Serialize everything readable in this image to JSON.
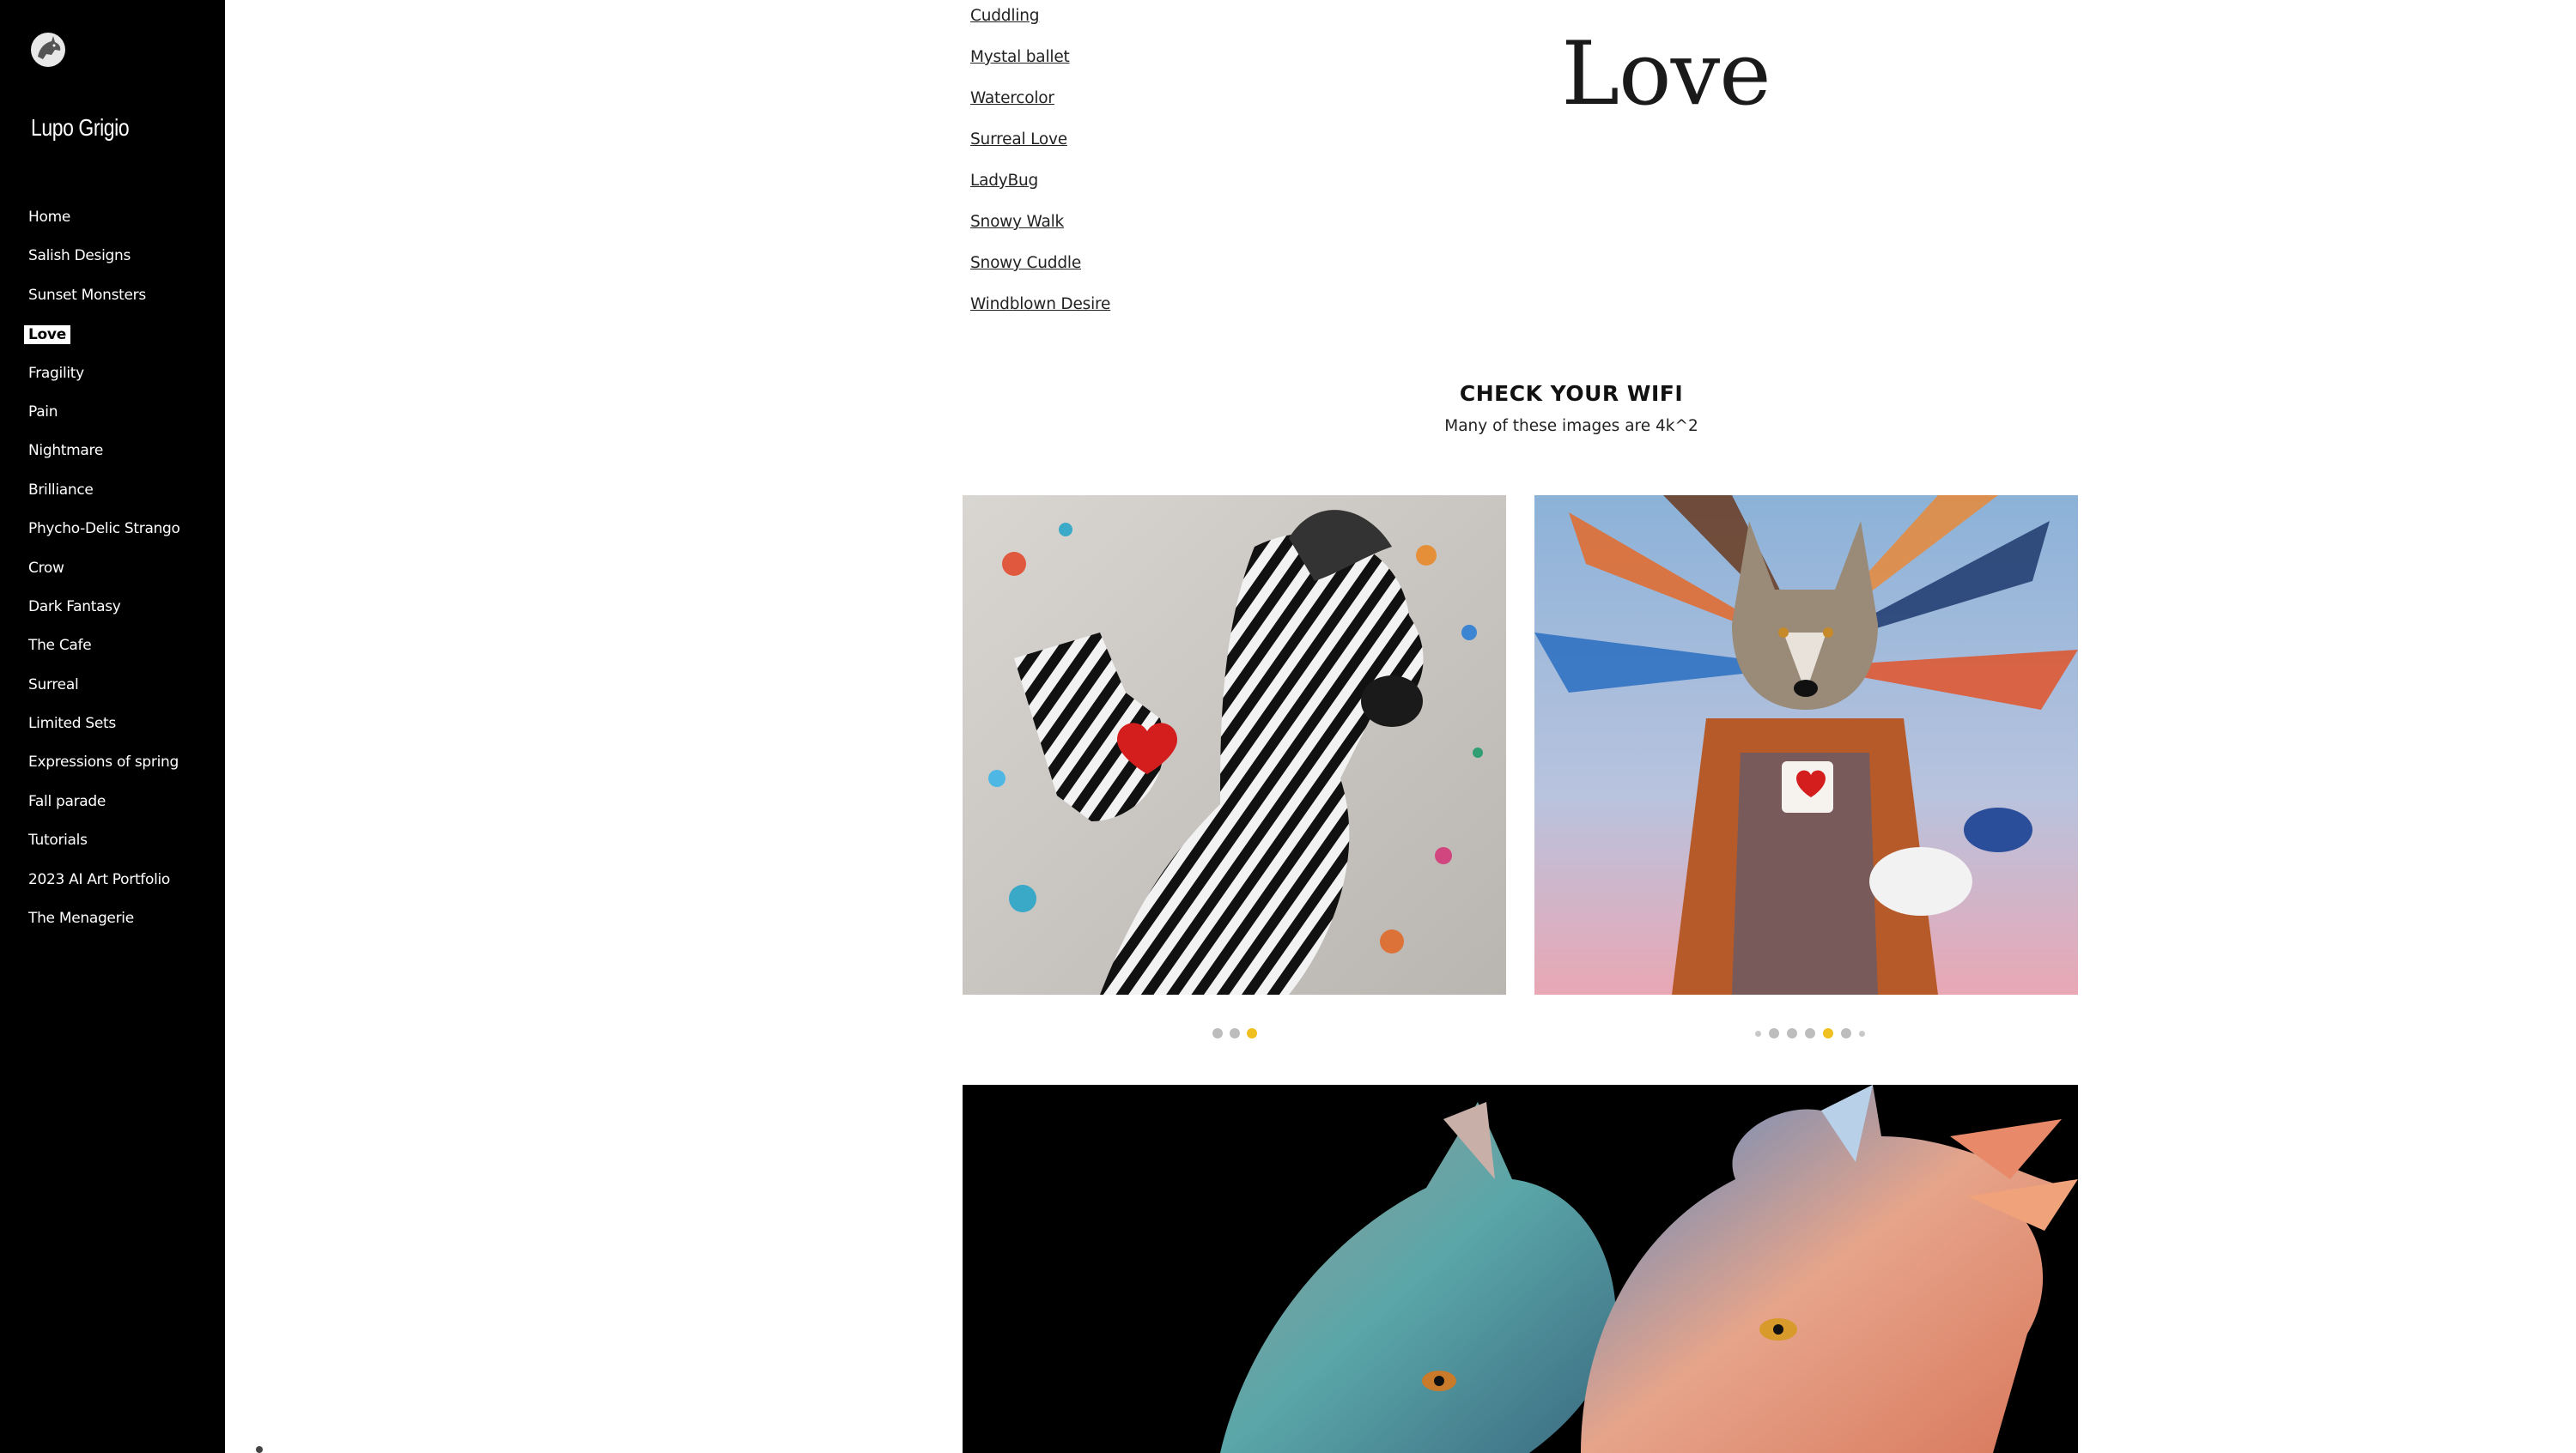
{
  "site": {
    "title": "Lupo Grigio",
    "logo_icon": "wolf-moon-logo-icon"
  },
  "nav": {
    "items": [
      {
        "label": "Home"
      },
      {
        "label": "Salish Designs"
      },
      {
        "label": "Sunset Monsters"
      },
      {
        "label": "Love",
        "active": true
      },
      {
        "label": "Fragility"
      },
      {
        "label": "Pain"
      },
      {
        "label": "Nightmare"
      },
      {
        "label": "Brilliance"
      },
      {
        "label": "Phycho-Delic Strango"
      },
      {
        "label": "Crow"
      },
      {
        "label": "Dark Fantasy"
      },
      {
        "label": "The Cafe"
      },
      {
        "label": "Surreal"
      },
      {
        "label": "Limited Sets"
      },
      {
        "label": "Expressions of spring"
      },
      {
        "label": "Fall parade"
      },
      {
        "label": "Tutorials"
      },
      {
        "label": "2023 AI Art Portfolio"
      },
      {
        "label": "The Menagerie"
      }
    ]
  },
  "content": {
    "links": [
      "Cuddling",
      "Mystal ballet",
      "Watercolor",
      "Surreal Love",
      "LadyBug",
      "Snowy Walk",
      "Snowy Cuddle",
      "Windblown Desire"
    ],
    "page_title": "Love",
    "wifi_heading": "CHECK YOUR WIFI",
    "wifi_subtext": "Many of these images are 4k^2"
  },
  "galleries": [
    {
      "subject": "zebra with heart glove",
      "slides": 3,
      "active_slide": 3
    },
    {
      "subject": "wolf in I love shirt",
      "slides": 7,
      "active_slide": 5
    },
    {
      "subject": "two feathered wolves"
    }
  ],
  "colors": {
    "sidebar": "#000000",
    "active_dot": "#f0c020",
    "inactive_dot": "#bdbdbd"
  }
}
